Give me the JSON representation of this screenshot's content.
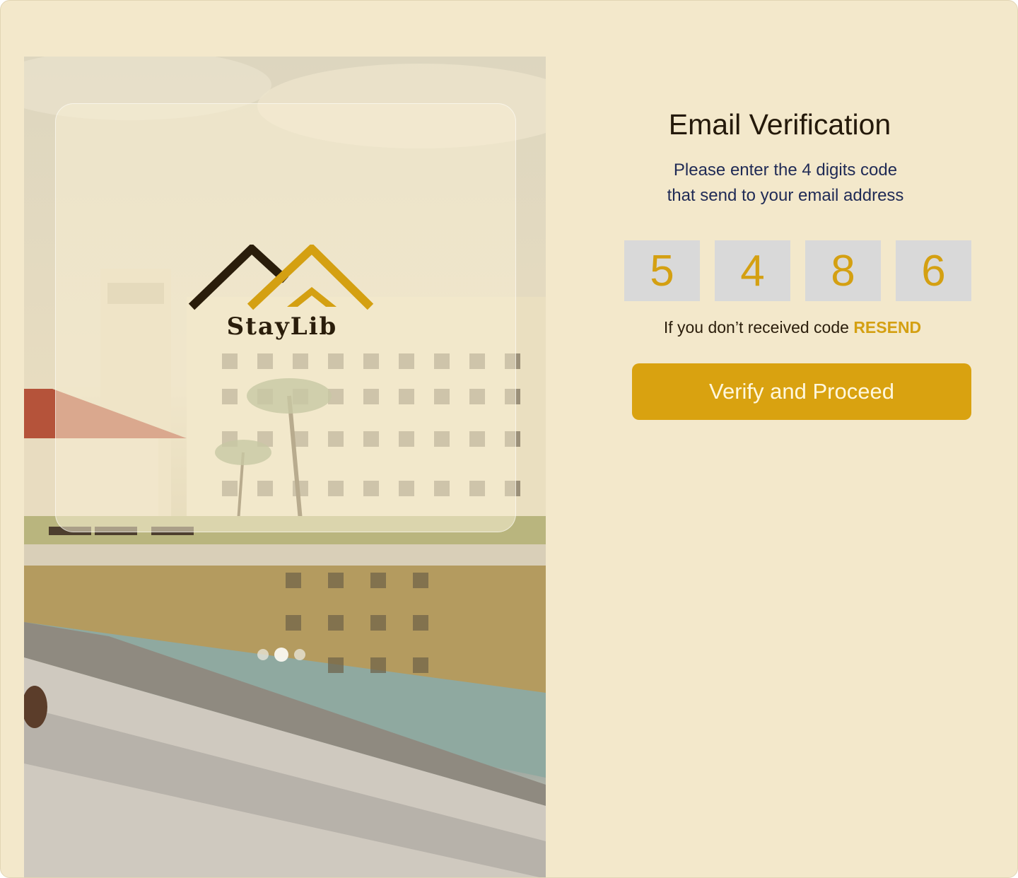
{
  "brand": {
    "name": "StayLib"
  },
  "hero": {
    "carousel": {
      "count": 3,
      "active_index": 1
    }
  },
  "form": {
    "title": "Email Verification",
    "subtitle_line1": "Please enter the 4 digits code",
    "subtitle_line2": "that send to your email address",
    "code_digits": [
      "5",
      "4",
      "8",
      "6"
    ],
    "resend_prompt": "If you don’t received code",
    "resend_label": "RESEND",
    "verify_button_label": "Verify and Proceed"
  },
  "colors": {
    "background": "#f3e8cb",
    "accent": "#d9a210",
    "title": "#24190a",
    "subtitle": "#1f2a55",
    "code_box": "#d9d9d9",
    "code_digit": "#d4a012"
  }
}
